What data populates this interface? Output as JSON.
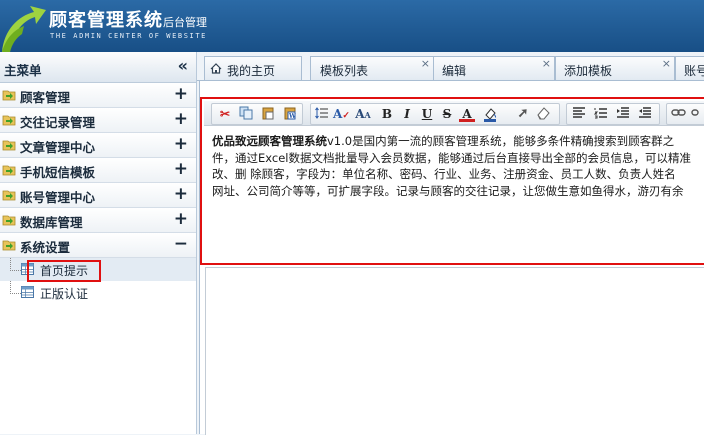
{
  "header": {
    "title": "顾客管理系统",
    "title_suffix": "后台管理",
    "subtitle": "THE ADMIN CENTER OF WEBSITE"
  },
  "sidebar": {
    "title": "主菜单",
    "collapse_icon": "«",
    "items": [
      {
        "label": "顾客管理",
        "toggle": "+"
      },
      {
        "label": "交往记录管理",
        "toggle": "+"
      },
      {
        "label": "文章管理中心",
        "toggle": "+"
      },
      {
        "label": "手机短信模板",
        "toggle": "+"
      },
      {
        "label": "账号管理中心",
        "toggle": "+"
      },
      {
        "label": "数据库管理",
        "toggle": "+"
      },
      {
        "label": "系统设置",
        "toggle": "−"
      }
    ],
    "sub_items": [
      {
        "label": "首页提示",
        "selected": true
      },
      {
        "label": "正版认证",
        "selected": false
      }
    ]
  },
  "tabs": [
    {
      "label": "我的主页",
      "closable": false
    },
    {
      "label": "模板列表",
      "closable": true
    },
    {
      "label": "编辑",
      "closable": true
    },
    {
      "label": "添加模板",
      "closable": true
    },
    {
      "label": "账号",
      "closable": false
    }
  ],
  "editor": {
    "toolbar_buttons": [
      "cut-icon",
      "copy-icon",
      "paste-icon",
      "paste-word-icon",
      "line-spacing-icon",
      "spell-check-icon",
      "font-size-icon",
      "bold",
      "italic",
      "underline",
      "strikethrough",
      "font-color-icon",
      "highlight-icon",
      "select-icon",
      "eraser-icon",
      "align-left-icon",
      "ordered-list-icon",
      "indent-icon",
      "outdent-icon",
      "link-icon"
    ],
    "content": {
      "brand": "优品致远顾客管理系统",
      "line1": "v1.0是国内第一流的顾客管理系统，能够多条件精确搜索到顾客群之",
      "line2": "件，通过Excel数据文档批量导入会员数据，能够通过后台直接导出全部的会员信息，可以精准",
      "line3": "改、删 除顾客，字段为：单位名称、密码、行业、业务、注册资金、员工人数、负责人姓名",
      "line4": "网址、公司简介等等，可扩展字段。记录与顾客的交往记录，让您做生意如鱼得水，游刃有余"
    }
  },
  "colors": {
    "header_bg": "#1f5d97",
    "highlight": "#e01010",
    "sidebar_bg": "#ffffff"
  }
}
